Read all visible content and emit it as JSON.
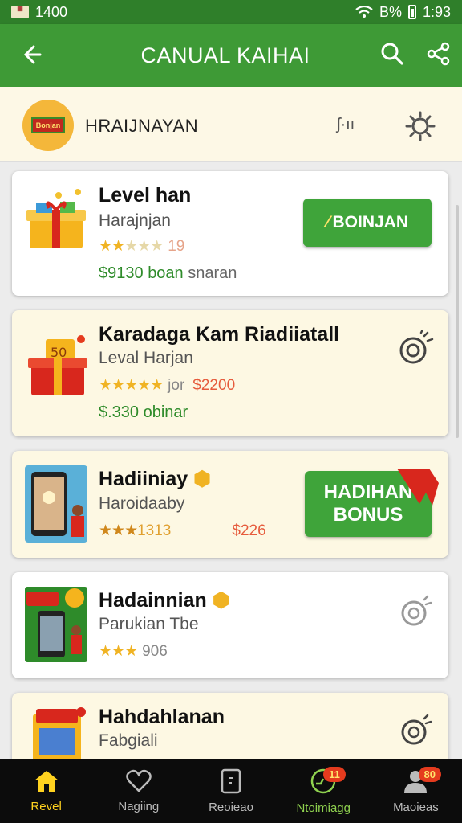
{
  "status_bar": {
    "time": "1400",
    "signal_text": "B%",
    "clock": "1:93"
  },
  "app_bar": {
    "title": "CANUAL KAIHAI"
  },
  "shop_header": {
    "logo_text": "Bonjan",
    "name": "HRAIJNAYAN",
    "icon_text": "ʃ·ıı"
  },
  "cards": [
    {
      "title": "Level han",
      "subtitle": "Harajnjan",
      "rating_count": "19",
      "extra_amount": "$9130",
      "extra_green": "boan",
      "extra_gray": "snaran",
      "button": "BOINJAN"
    },
    {
      "title": "Karadaga Kam Riadiiatall",
      "subtitle": "Leval Harjan",
      "rating_text": "jor",
      "price": "$2200",
      "extra": "$.330 obinar"
    },
    {
      "title": "Hadiiniay",
      "subtitle": "Haroidaaby",
      "rating_count": "1313",
      "price": "$226",
      "button_line1": "HADIHAN",
      "button_line2": "BONUS"
    },
    {
      "title": "Hadainnian",
      "subtitle": "Parukian Tbe",
      "rating_count": "906"
    },
    {
      "title": "Hahdahlanan",
      "subtitle": "Fabgiali"
    }
  ],
  "bottom_nav": [
    {
      "label": "Revel"
    },
    {
      "label": "Nagiing"
    },
    {
      "label": "Reoieao"
    },
    {
      "label": "Ntoimiagg",
      "badge": "11"
    },
    {
      "label": "Maoieas",
      "badge": "80"
    }
  ],
  "colors": {
    "primary": "#3e9a36",
    "status": "#2f7f2a",
    "cream": "#fdf8e3",
    "star": "#f0b323",
    "price": "#e65b3c"
  }
}
